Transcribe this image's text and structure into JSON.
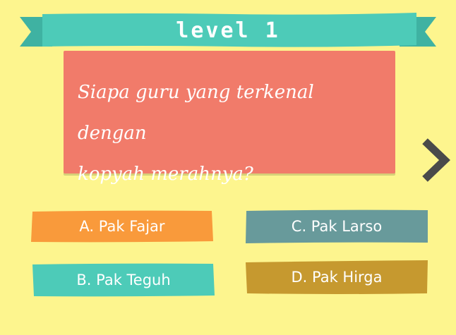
{
  "level": {
    "title": "level 1",
    "ribbon_color": "#4dcbb8"
  },
  "question": {
    "line1": "Siapa guru yang terkenal dengan",
    "line2": "kopyah merahnya?",
    "card_color": "#f17b6a"
  },
  "next": {
    "icon": "chevron-right-icon",
    "color": "#4a4a4a"
  },
  "answers": [
    {
      "letter": "A",
      "label": "A. Pak Fajar",
      "color": "#f99a3b"
    },
    {
      "letter": "B",
      "label": "B. Pak Teguh",
      "color": "#4dcbb8"
    },
    {
      "letter": "C",
      "label": "C. Pak Larso",
      "color": "#689a9b"
    },
    {
      "letter": "D",
      "label": "D. Pak Hirga",
      "color": "#c6992f"
    }
  ],
  "colors": {
    "background": "#fdf58e"
  }
}
